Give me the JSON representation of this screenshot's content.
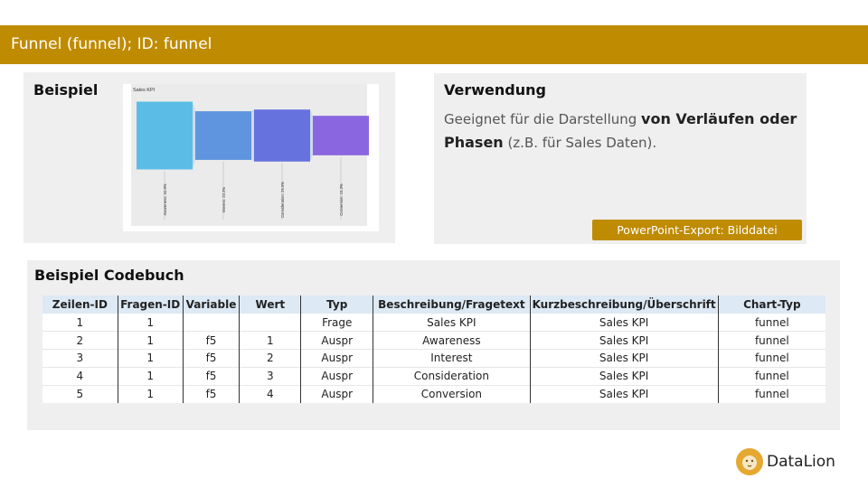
{
  "header": {
    "title": "Funnel (funnel); ID: funnel"
  },
  "beispiel": {
    "title": "Beispiel"
  },
  "chart_data": {
    "type": "funnel",
    "title": "Sales KPI",
    "categories": [
      "Awareness",
      "Interest",
      "Consideration",
      "Conversion"
    ],
    "values": [
      34.9,
      23.2,
      26.5,
      15.3
    ],
    "labels": [
      "Awareness: 34.9%",
      "Interest: 23.2%",
      "Consideration: 26.5%",
      "Conversion: 15.3%"
    ],
    "colors": [
      "#5bbde6",
      "#5e95de",
      "#6672de",
      "#8a66e0"
    ]
  },
  "verwendung": {
    "title": "Verwendung",
    "text_1": "Geeignet für die Darstellung ",
    "text_strong": "von Verläufen oder Phasen",
    "text_2": " (z.B. für Sales Daten).",
    "export_badge": "PowerPoint-Export: Bilddatei"
  },
  "codebuch": {
    "title": "Beispiel Codebuch",
    "columns": [
      "Zeilen-ID",
      "Fragen-ID",
      "Variable",
      "Wert",
      "Typ",
      "Beschreibung/Fragetext",
      "Kurzbeschreibung/Überschrift",
      "Chart-Typ"
    ],
    "rows": [
      [
        "1",
        "1",
        "",
        "",
        "Frage",
        "Sales KPI",
        "Sales KPI",
        "funnel"
      ],
      [
        "2",
        "1",
        "f5",
        "1",
        "Auspr",
        "Awareness",
        "Sales KPI",
        "funnel"
      ],
      [
        "3",
        "1",
        "f5",
        "2",
        "Auspr",
        "Interest",
        "Sales KPI",
        "funnel"
      ],
      [
        "4",
        "1",
        "f5",
        "3",
        "Auspr",
        "Consideration",
        "Sales KPI",
        "funnel"
      ],
      [
        "5",
        "1",
        "f5",
        "4",
        "Auspr",
        "Conversion",
        "Sales KPI",
        "funnel"
      ]
    ]
  },
  "logo": {
    "text": "DataLion"
  }
}
